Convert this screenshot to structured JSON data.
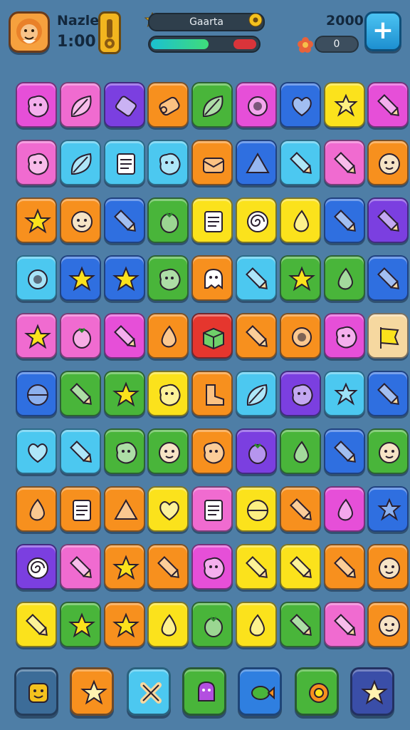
{
  "hud": {
    "player_name": "Nazle",
    "timer": "1:00",
    "level_banner": "Gaarta",
    "score": "2000",
    "score_pill": "0",
    "progress": 0.78
  },
  "palette": {
    "magenta": "#e64fd8",
    "pink": "#f06bd0",
    "purple": "#7b3fe0",
    "orange": "#f7901e",
    "green": "#49b53a",
    "blue": "#2f6fe0",
    "yellow": "#fbe21c",
    "sky": "#4cc8f0",
    "red": "#e5362e",
    "cream": "#f6d8a0"
  },
  "board": {
    "rows": 10,
    "cols": 9,
    "tiles": [
      [
        "magenta:blob",
        "pink:leaf",
        "purple:candy",
        "orange:roll",
        "green:leaf",
        "magenta:ring",
        "blue:heart",
        "yellow:flower",
        "magenta:pencil"
      ],
      [
        "pink:blob",
        "sky:leaf",
        "sky:note",
        "sky:blob",
        "orange:bag",
        "blue:triangle",
        "sky:pencil",
        "pink:pencil",
        "orange:face"
      ],
      [
        "orange:star",
        "orange:face",
        "blue:pencil",
        "green:berry",
        "yellow:note",
        "yellow:spiral",
        "yellow:drop",
        "blue:pencil",
        "purple:pencil"
      ],
      [
        "sky:ring",
        "blue:star",
        "blue:star",
        "green:blob",
        "orange:ghost",
        "sky:pencil",
        "green:star",
        "green:drop",
        "blue:pencil"
      ],
      [
        "pink:star",
        "pink:berry",
        "magenta:pencil",
        "orange:drop",
        "red:box",
        "orange:pencil",
        "orange:ring",
        "magenta:blob",
        "cream:flag"
      ],
      [
        "blue:ball",
        "green:pencil",
        "green:star",
        "yellow:blob",
        "orange:boot",
        "sky:leaf",
        "purple:blob",
        "sky:flower",
        "blue:pencil"
      ],
      [
        "sky:heart",
        "sky:pencil",
        "green:blob",
        "green:face",
        "orange:blob",
        "purple:berry",
        "green:drop",
        "blue:pencil",
        "green:face"
      ],
      [
        "orange:drop",
        "orange:note",
        "orange:triangle",
        "yellow:heart",
        "pink:note",
        "yellow:ball",
        "orange:pencil",
        "magenta:drop",
        "blue:flower"
      ],
      [
        "purple:spiral",
        "pink:pencil",
        "orange:star",
        "orange:pencil",
        "magenta:blob",
        "yellow:pencil",
        "yellow:pencil",
        "orange:pencil",
        "orange:face"
      ],
      [
        "yellow:pencil",
        "green:star",
        "orange:star",
        "yellow:drop",
        "green:berry",
        "yellow:drop",
        "green:pencil",
        "pink:pencil",
        "orange:face"
      ]
    ]
  },
  "toolbar": {
    "tools": [
      {
        "name": "tool-smile-block",
        "color": "#3c6c98",
        "icon": "smile-icon"
      },
      {
        "name": "tool-star-burst",
        "color": "#f7901e",
        "icon": "star-icon"
      },
      {
        "name": "tool-cross-swap",
        "color": "#4cc8f0",
        "icon": "cross-icon"
      },
      {
        "name": "tool-monster",
        "color": "#49b53a",
        "icon": "monster-icon"
      },
      {
        "name": "tool-fish",
        "color": "#2f7fe0",
        "icon": "fish-icon"
      },
      {
        "name": "tool-gear",
        "color": "#49b53a",
        "icon": "gear-icon"
      },
      {
        "name": "tool-star",
        "color": "#3a4ea8",
        "icon": "star-icon"
      }
    ]
  }
}
